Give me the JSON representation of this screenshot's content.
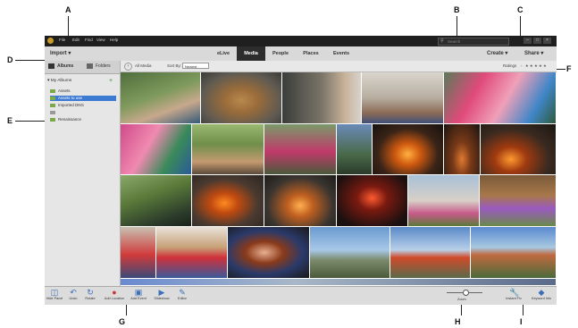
{
  "callouts": [
    "A",
    "B",
    "C",
    "D",
    "E",
    "F",
    "G",
    "H",
    "I"
  ],
  "titlebar": {
    "menu": [
      "File",
      "Edit",
      "Find",
      "View",
      "Help"
    ],
    "search_placeholder": "Search"
  },
  "toolbar": {
    "import_label": "Import",
    "tabs": [
      "eLive",
      "Media",
      "People",
      "Places",
      "Events"
    ],
    "active_tab": "Media",
    "create_label": "Create",
    "share_label": "Share"
  },
  "sidebar": {
    "tabs": [
      "Albums",
      "Folders"
    ],
    "my_albums": "My Albums",
    "albums": [
      "Assets",
      "Assets to use",
      "Imported DNG",
      "Renaissance"
    ],
    "selected_album": "Assets to use"
  },
  "filterbar": {
    "back_label": "All Media",
    "sort_label": "Sort By:",
    "sort_value": "Newest",
    "ratings_label": "Ratings"
  },
  "bottombar": {
    "items": [
      "Hide Panel",
      "Undo",
      "Rotate",
      "Add Location",
      "Add Event",
      "Slideshow",
      "Editor"
    ],
    "zoom_label": "Zoom",
    "right_items": [
      "Instant Fix",
      "Keyword Info"
    ]
  },
  "colors": {
    "accent": "#3d7bd3",
    "active_tab_bg": "#2d2d2d",
    "album_swatch": "#7aa84a"
  }
}
